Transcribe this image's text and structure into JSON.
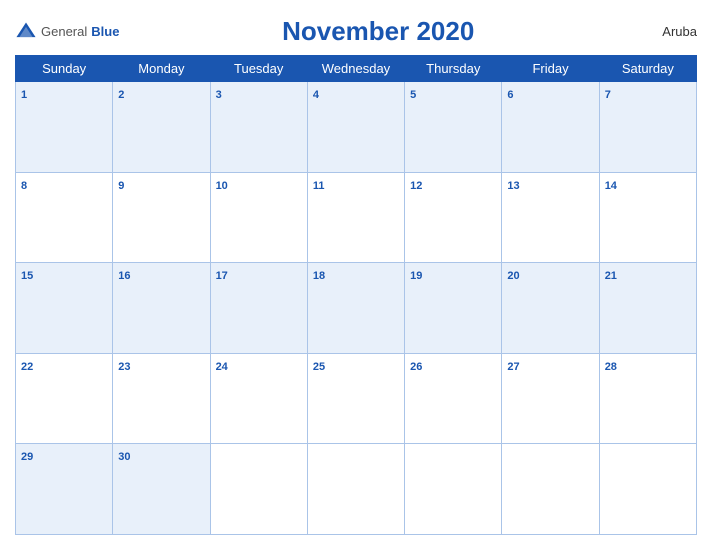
{
  "header": {
    "logo_general": "General",
    "logo_blue": "Blue",
    "title": "November 2020",
    "country": "Aruba"
  },
  "weekdays": [
    "Sunday",
    "Monday",
    "Tuesday",
    "Wednesday",
    "Thursday",
    "Friday",
    "Saturday"
  ],
  "weeks": [
    [
      {
        "day": 1,
        "empty": false
      },
      {
        "day": 2,
        "empty": false
      },
      {
        "day": 3,
        "empty": false
      },
      {
        "day": 4,
        "empty": false
      },
      {
        "day": 5,
        "empty": false
      },
      {
        "day": 6,
        "empty": false
      },
      {
        "day": 7,
        "empty": false
      }
    ],
    [
      {
        "day": 8,
        "empty": false
      },
      {
        "day": 9,
        "empty": false
      },
      {
        "day": 10,
        "empty": false
      },
      {
        "day": 11,
        "empty": false
      },
      {
        "day": 12,
        "empty": false
      },
      {
        "day": 13,
        "empty": false
      },
      {
        "day": 14,
        "empty": false
      }
    ],
    [
      {
        "day": 15,
        "empty": false
      },
      {
        "day": 16,
        "empty": false
      },
      {
        "day": 17,
        "empty": false
      },
      {
        "day": 18,
        "empty": false
      },
      {
        "day": 19,
        "empty": false
      },
      {
        "day": 20,
        "empty": false
      },
      {
        "day": 21,
        "empty": false
      }
    ],
    [
      {
        "day": 22,
        "empty": false
      },
      {
        "day": 23,
        "empty": false
      },
      {
        "day": 24,
        "empty": false
      },
      {
        "day": 25,
        "empty": false
      },
      {
        "day": 26,
        "empty": false
      },
      {
        "day": 27,
        "empty": false
      },
      {
        "day": 28,
        "empty": false
      }
    ],
    [
      {
        "day": 29,
        "empty": false
      },
      {
        "day": 30,
        "empty": false
      },
      {
        "day": null,
        "empty": true
      },
      {
        "day": null,
        "empty": true
      },
      {
        "day": null,
        "empty": true
      },
      {
        "day": null,
        "empty": true
      },
      {
        "day": null,
        "empty": true
      }
    ]
  ]
}
